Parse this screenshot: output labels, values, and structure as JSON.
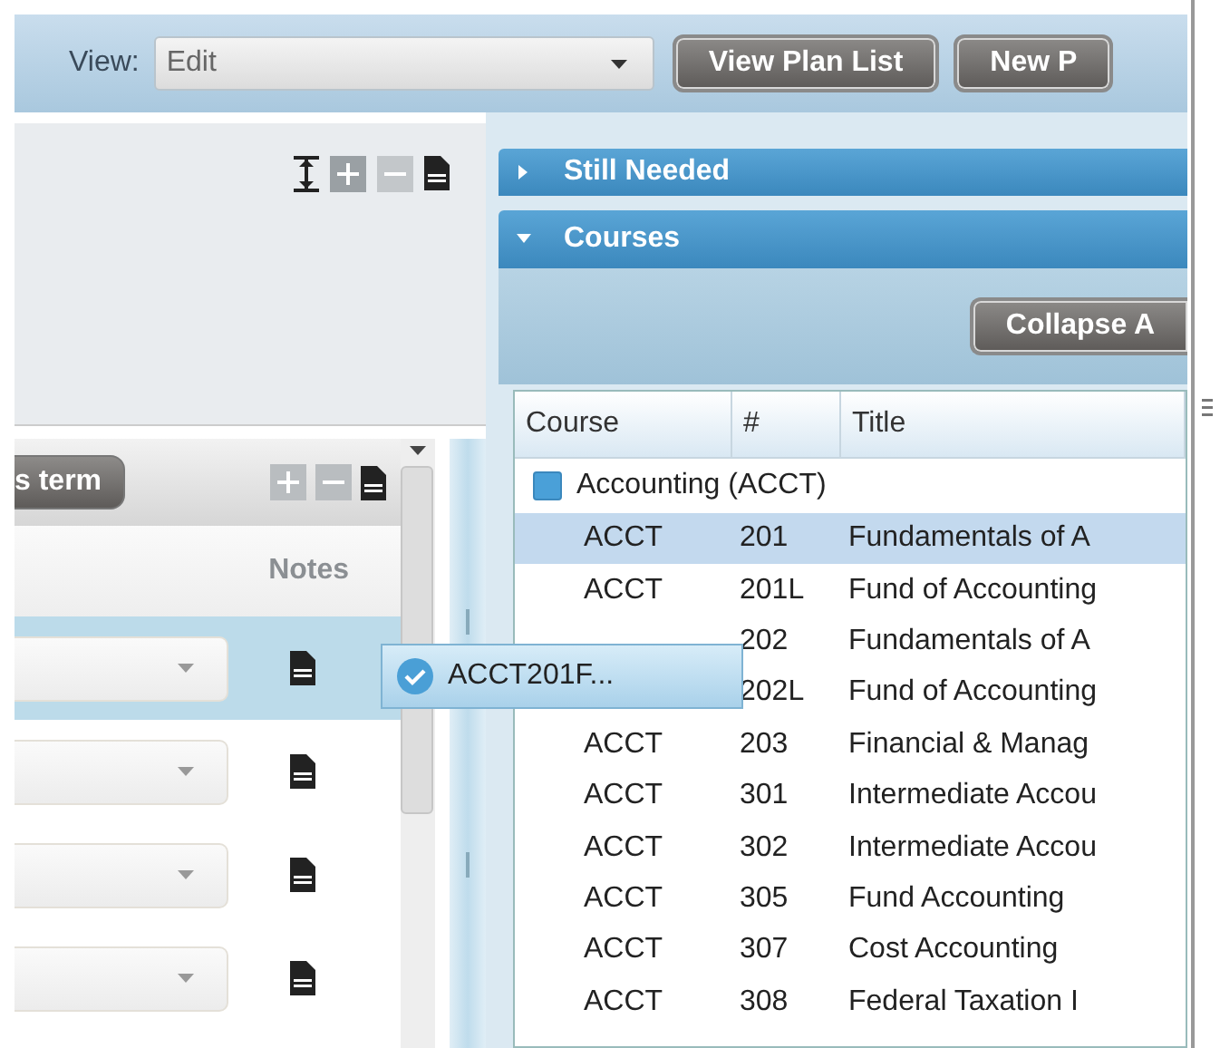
{
  "view": {
    "label": "View:",
    "value": "Edit"
  },
  "toolbar_buttons": [
    "View Plan List",
    "New P"
  ],
  "left_panel": {
    "term_button": "s term",
    "notes_header": "Notes",
    "rows": [
      {
        "selected": true
      },
      {
        "selected": false
      },
      {
        "selected": false
      },
      {
        "selected": false
      }
    ]
  },
  "drag_item": {
    "label": "ACCT201F...",
    "checked": true
  },
  "sections": [
    {
      "title": "Still Needed",
      "expanded": false
    },
    {
      "title": "Courses",
      "expanded": true
    }
  ],
  "courses": {
    "action_button": "Collapse A",
    "columns": [
      "Course",
      "#",
      "Title"
    ],
    "group": {
      "label": "Accounting (ACCT)",
      "checked": true
    },
    "rows": [
      {
        "course": "ACCT",
        "number": "201",
        "title": "Fundamentals of A",
        "selected": true
      },
      {
        "course": "ACCT",
        "number": "201L",
        "title": "Fund of Accounting",
        "selected": false
      },
      {
        "number": "202",
        "title": "Fundamentals of A",
        "selected": false
      },
      {
        "number": "202L",
        "title": "Fund of Accounting",
        "selected": false
      },
      {
        "course": "ACCT",
        "number": "203",
        "title": "Financial & Manag",
        "selected": false
      },
      {
        "course": "ACCT",
        "number": "301",
        "title": "Intermediate Accou",
        "selected": false
      },
      {
        "course": "ACCT",
        "number": "302",
        "title": "Intermediate Accou",
        "selected": false
      },
      {
        "course": "ACCT",
        "number": "305",
        "title": "Fund Accounting",
        "selected": false
      },
      {
        "course": "ACCT",
        "number": "307",
        "title": "Cost Accounting",
        "selected": false
      },
      {
        "course": "ACCT",
        "number": "308",
        "title": "Federal Taxation I",
        "selected": false
      }
    ]
  }
}
